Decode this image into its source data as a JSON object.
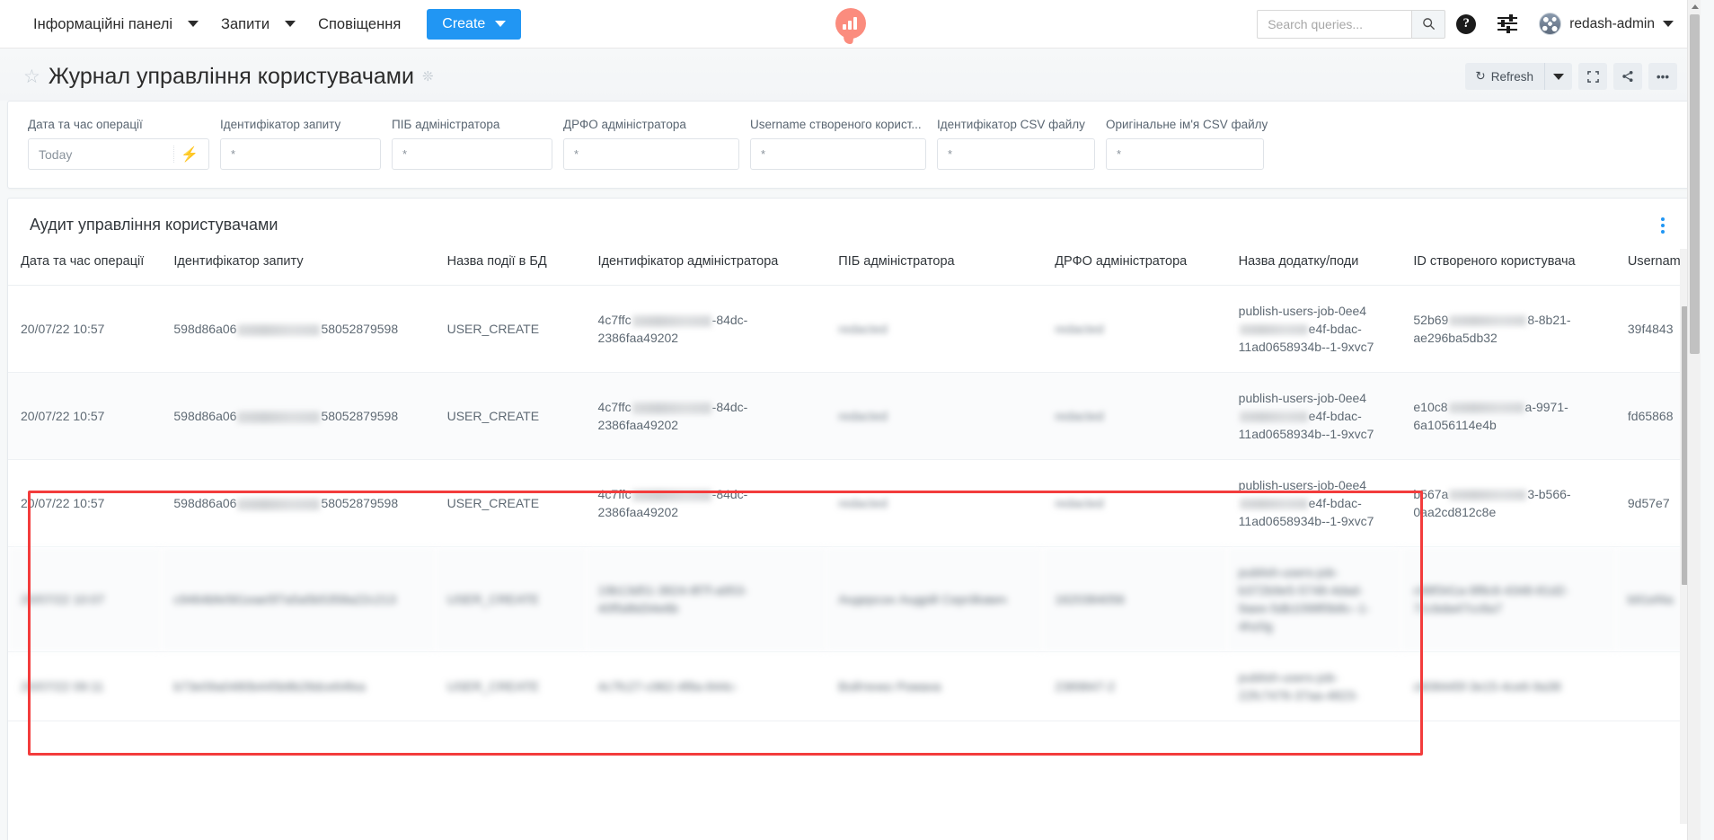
{
  "navbar": {
    "items": [
      {
        "label": "Інформаційні панелі",
        "has_caret": true
      },
      {
        "label": "Запити",
        "has_caret": true
      },
      {
        "label": "Сповіщення",
        "has_caret": false
      }
    ],
    "create_button": "Create",
    "logo_name": "redash-logo",
    "search": {
      "placeholder": "Search queries...",
      "value": ""
    },
    "help_icon": "?",
    "settings_icon": "sliders-icon",
    "user": "redash-admin"
  },
  "header": {
    "star_icon": "☆",
    "title": "Журнал управління користувачами",
    "gear_icon": "❊",
    "refresh_label": "Refresh",
    "refresh_icon": "↻",
    "fullscreen_icon": "⛶",
    "share_icon": "share-icon",
    "more_icon": "•••"
  },
  "filters": [
    {
      "label": "Дата та час операції",
      "value": "Today",
      "type": "date",
      "bolt": "⚡"
    },
    {
      "label": "Ідентифікатор запиту",
      "value": "*",
      "type": "text"
    },
    {
      "label": "ПІБ адміністратора",
      "value": "*",
      "type": "text"
    },
    {
      "label": "ДРФО адміністратора",
      "value": "*",
      "type": "text"
    },
    {
      "label": "Username створеного корист...",
      "value": "*",
      "type": "text"
    },
    {
      "label": "Ідентифікатор CSV файлу",
      "value": "*",
      "type": "text"
    },
    {
      "label": "Оригінальне ім'я CSV файлу",
      "value": "*",
      "type": "text"
    }
  ],
  "widget": {
    "title": "Аудит управління користувачами",
    "menu_icon": "kebab-icon",
    "columns": [
      "Дата та час операції",
      "Ідентифікатор запиту",
      "Назва події в БД",
      "Ідентифікатор адміністратора",
      "ПІБ адміністратора",
      "ДРФО адміністратора",
      "Назва додатку/поди",
      "ID створеного користувача",
      "Usernam"
    ],
    "rows": [
      {
        "date": "20/07/22 10:57",
        "request_id_prefix": "598d86a06",
        "request_id_suffix": "58052879598",
        "event": "USER_CREATE",
        "admin_id_prefix": "4c7ffc",
        "admin_id_suffix": "-84dc-2386faa49202",
        "admin_name": "redacted",
        "admin_drfo": "redacted",
        "app_name_prefix": "publish-users-job-0ee4",
        "app_name_suffix": "e4f-bdac-11ad0658934b--1-9xvc7",
        "user_id_prefix": "52b69",
        "user_id_suffix": "8-8b21-ae296ba5db32",
        "username": "39f4843",
        "redacted": false
      },
      {
        "date": "20/07/22 10:57",
        "request_id_prefix": "598d86a06",
        "request_id_suffix": "58052879598",
        "event": "USER_CREATE",
        "admin_id_prefix": "4c7ffc",
        "admin_id_suffix": "-84dc-2386faa49202",
        "admin_name": "redacted",
        "admin_drfo": "redacted",
        "app_name_prefix": "publish-users-job-0ee4",
        "app_name_suffix": "e4f-bdac-11ad0658934b--1-9xvc7",
        "user_id_prefix": "e10c8",
        "user_id_suffix": "a-9971-6a1056114e4b",
        "username": "fd65868",
        "redacted": false
      },
      {
        "date": "20/07/22 10:57",
        "request_id_prefix": "598d86a06",
        "request_id_suffix": "58052879598",
        "event": "USER_CREATE",
        "admin_id_prefix": "4c7ffc",
        "admin_id_suffix": "-84dc-2386faa49202",
        "admin_name": "redacted",
        "admin_drfo": "redacted",
        "app_name_prefix": "publish-users-job-0ee4",
        "app_name_suffix": "e4f-bdac-11ad0658934b--1-9xvc7",
        "user_id_prefix": "b567a",
        "user_id_suffix": "3-b566-0aa2cd812c8e",
        "username": "9d57e7",
        "redacted": false
      },
      {
        "date": "20/07/22 10:07",
        "request_id_prefix": "c9464bfe561eae5",
        "request_id_suffix": "f7a5a5b5358a22c213",
        "event": "USER_CREATE",
        "admin_id_prefix": "19b13d51-3824",
        "admin_id_suffix": "-8f7f-a953-40f5d8d34e6b",
        "admin_name": "Андерсон Андрій Сергійович",
        "admin_drfo": "1620384056",
        "app_name_prefix": "publish-users-job-",
        "app_name_suffix": "b372b9e5-5748-4dad-9aee-5db1098f0b8c--1-4hz0g",
        "user_id_prefix": "c98f341a-",
        "user_id_suffix": "9f8c6-4348-81d2-71cbda47cc6a7",
        "username": "b91ef4a",
        "redacted": true
      },
      {
        "date": "20/07/22 09:11",
        "request_id_prefix": "b73e09a0480b4",
        "request_id_suffix": "45b8b28dce64fea",
        "event": "USER_CREATE",
        "admin_id_prefix": "4c7fc27-c962",
        "admin_id_suffix": "-4f8a-844c-",
        "admin_name": "Войтенко Романа",
        "admin_drfo": "2389847-2",
        "app_name_prefix": "publish-users-job-",
        "app_name_suffix": "22fc7476-37aa-4823-",
        "user_id_prefix": "c608445f-",
        "user_id_suffix": "3e15-4ce6-9a38",
        "username": "",
        "redacted": true
      }
    ]
  },
  "colors": {
    "accent": "#2196f3",
    "highlight_box": "#f33c3c",
    "logo": "#fb8c7e",
    "page_bg": "#f6f8f9"
  }
}
